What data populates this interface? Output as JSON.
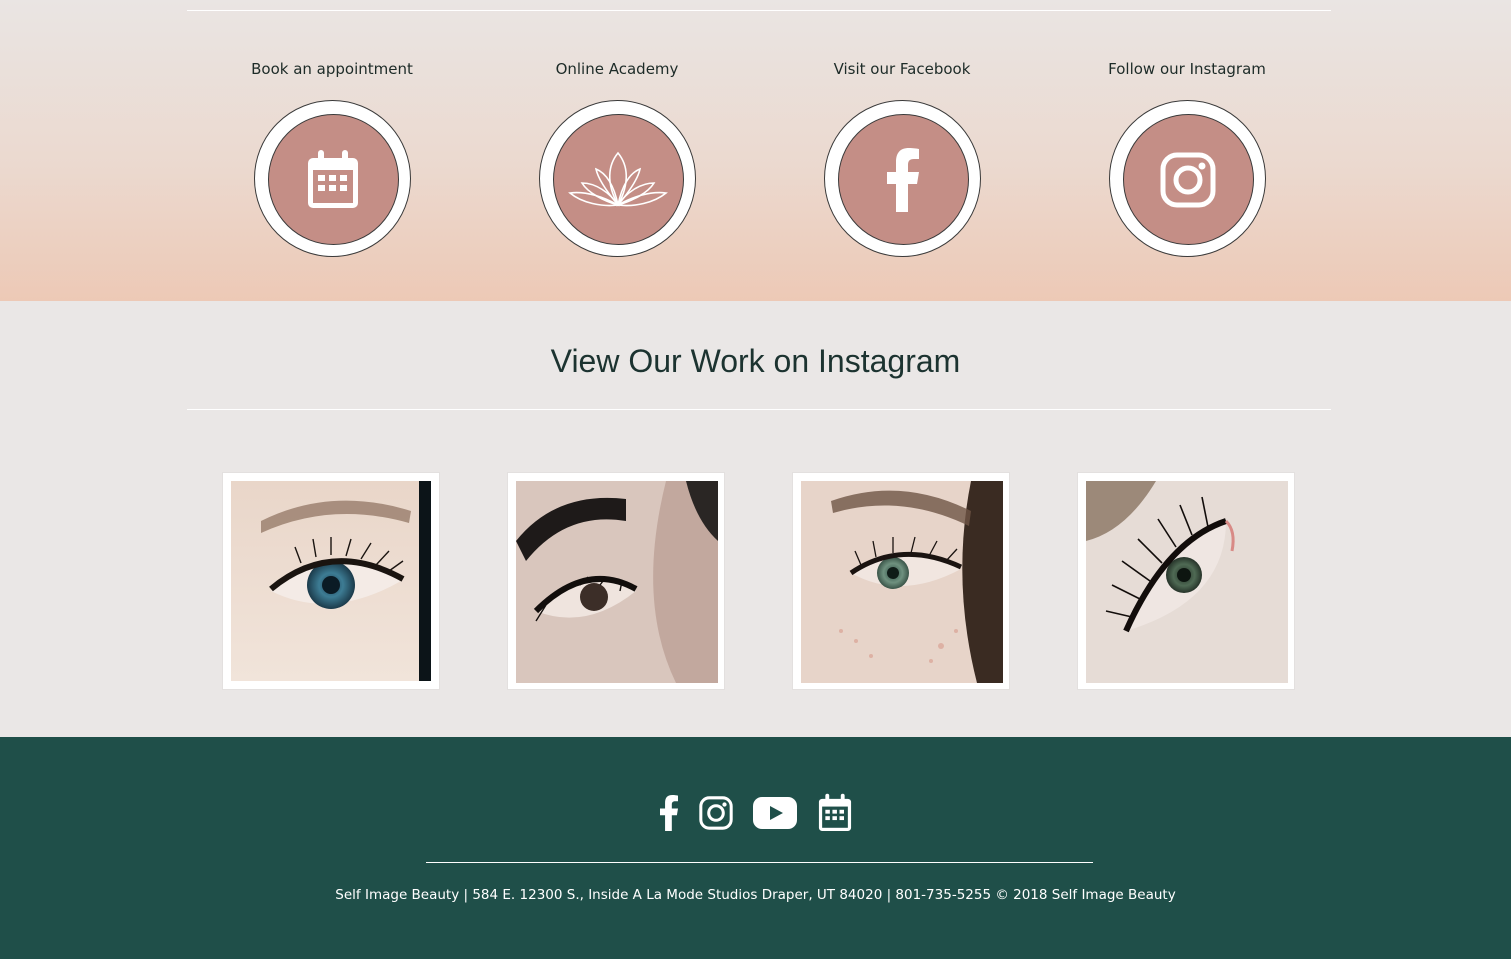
{
  "quick_links": {
    "items": [
      {
        "label": "Book an appointment",
        "icon": "calendar-icon"
      },
      {
        "label": "Online Academy",
        "icon": "lotus-icon"
      },
      {
        "label": "Visit our Facebook",
        "icon": "facebook-icon"
      },
      {
        "label": "Follow our Instagram",
        "icon": "instagram-icon"
      }
    ],
    "circle_color": "#c48e86"
  },
  "gallery": {
    "title": "View Our Work on Instagram",
    "photos": [
      {
        "subject": "eye-lash-extension-photo"
      },
      {
        "subject": "brow-and-lash-photo"
      },
      {
        "subject": "lash-extension-photo"
      },
      {
        "subject": "volume-lash-photo"
      }
    ]
  },
  "footer": {
    "background": "#1f4f49",
    "social_icons": [
      "facebook-icon",
      "instagram-icon",
      "youtube-icon",
      "calendar-icon"
    ],
    "text": "Self Image Beauty | 584 E. 12300 S., Inside A La Mode Studios Draper, UT 84020 | 801-735-5255 © 2018 Self Image Beauty"
  }
}
